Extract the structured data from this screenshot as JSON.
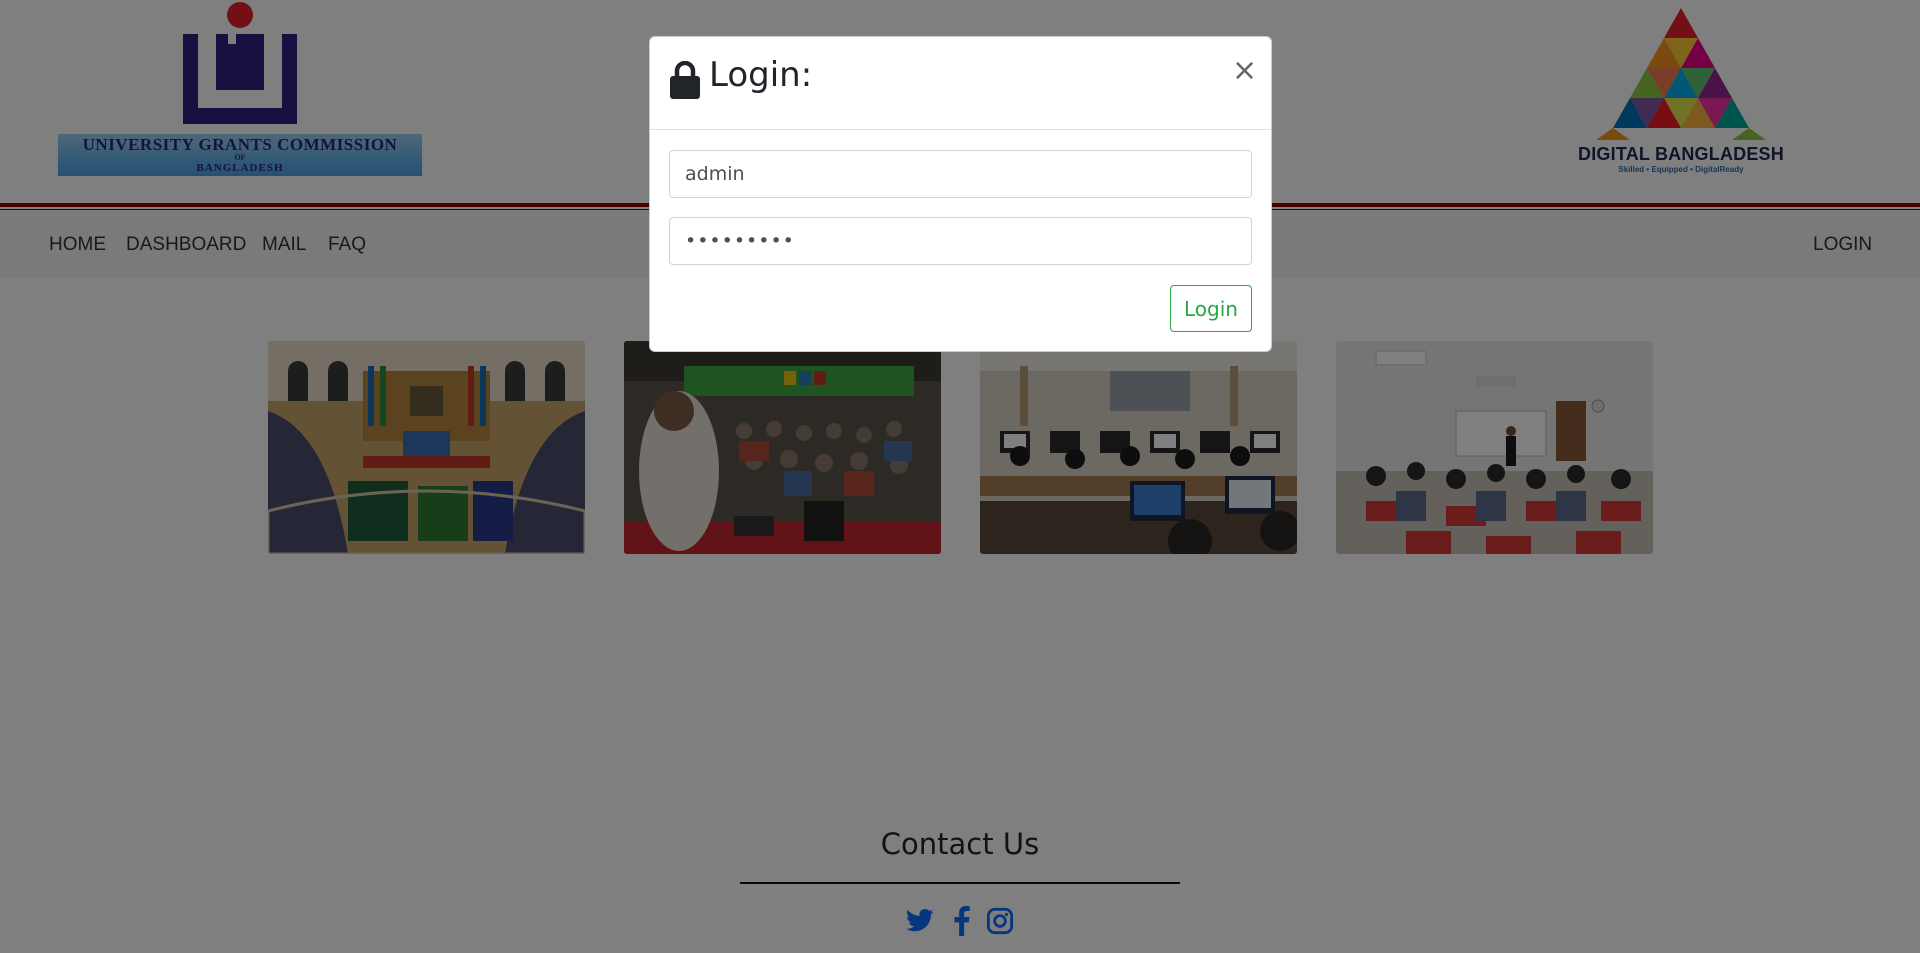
{
  "header": {
    "ugc_logo": {
      "line1": "UNIVERSITY GRANTS COMMISSION",
      "line2": "OF",
      "line3": "BANGLADESH"
    },
    "digital_bangladesh_logo": {
      "title": "DIGITAL BANGLADESH",
      "tagline": "Skilled • Equipped • DigitalReady"
    }
  },
  "nav": {
    "left_items": [
      "HOME",
      "DASHBOARD",
      "MAIL",
      "FAQ"
    ],
    "right_item": "LOGIN"
  },
  "gallery": {
    "photos": [
      "convocation-hall-icon",
      "seminar-audience-icon",
      "computer-lab-icon",
      "classroom-lecture-icon"
    ]
  },
  "footer": {
    "contact_title": "Contact Us",
    "social_icons": [
      "twitter-icon",
      "facebook-icon",
      "instagram-icon"
    ],
    "social_color": "#0d6efd"
  },
  "modal": {
    "title": "Login:",
    "close_symbol": "×",
    "username_value": "admin",
    "password_value": "•••••••••",
    "submit_label": "Login",
    "submit_color": "#28a745"
  },
  "colors": {
    "header_rule": "#8b0000",
    "navbar_bg": "#f4f4f4",
    "backdrop": "rgba(0,0,0,0.5)"
  }
}
